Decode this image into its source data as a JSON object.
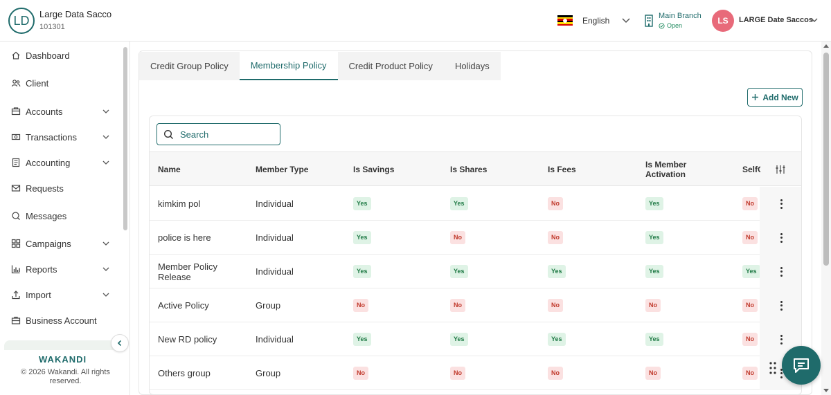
{
  "header": {
    "org_initials": "LD",
    "org_name": "Large Data Sacco",
    "org_code": "101301",
    "language": "English",
    "branch_name": "Main Branch",
    "branch_status": "Open",
    "user_initials": "LS",
    "user_name": "LARGE Date Saccos"
  },
  "sidebar": {
    "items": [
      {
        "label": "Dashboard",
        "icon": "home-icon"
      },
      {
        "label": "Client",
        "icon": "users-icon"
      },
      {
        "label": "Accounts",
        "icon": "wallet-icon",
        "expandable": true
      },
      {
        "label": "Transactions",
        "icon": "money-icon",
        "expandable": true
      },
      {
        "label": "Accounting",
        "icon": "ledger-icon",
        "expandable": true
      },
      {
        "label": "Requests",
        "icon": "mail-icon"
      },
      {
        "label": "Messages",
        "icon": "chat-icon"
      },
      {
        "label": "Campaigns",
        "icon": "grid-icon",
        "expandable": true
      },
      {
        "label": "Reports",
        "icon": "bar-chart-icon",
        "expandable": true
      },
      {
        "label": "Import",
        "icon": "upload-icon",
        "expandable": true
      },
      {
        "label": "Business Account",
        "icon": "briefcase-icon"
      }
    ],
    "brand": "WAKANDI",
    "copyright": "© 2026 Wakandi. All rights reserved."
  },
  "tabs": [
    {
      "label": "Credit Group Policy",
      "active": false
    },
    {
      "label": "Membership Policy",
      "active": true
    },
    {
      "label": "Credit Product Policy",
      "active": false
    },
    {
      "label": "Holidays",
      "active": false
    }
  ],
  "toolbar": {
    "add_label": "Add New"
  },
  "search": {
    "placeholder": "Search",
    "value": ""
  },
  "table": {
    "columns": [
      "Name",
      "Member Type",
      "Is Savings",
      "Is Shares",
      "Is Fees",
      "Is Member Activation",
      "SelfO"
    ],
    "rows": [
      {
        "name": "kimkim pol",
        "member_type": "Individual",
        "flags": [
          "Yes",
          "Yes",
          "No",
          "Yes",
          "No"
        ]
      },
      {
        "name": "police is here",
        "member_type": "Individual",
        "flags": [
          "Yes",
          "No",
          "No",
          "Yes",
          "No"
        ]
      },
      {
        "name": "Member Policy Release",
        "member_type": "Individual",
        "flags": [
          "Yes",
          "Yes",
          "Yes",
          "Yes",
          "Yes"
        ]
      },
      {
        "name": "Active Policy",
        "member_type": "Group",
        "flags": [
          "No",
          "No",
          "No",
          "No",
          "No"
        ]
      },
      {
        "name": "New RD policy",
        "member_type": "Individual",
        "flags": [
          "Yes",
          "Yes",
          "Yes",
          "Yes",
          "No"
        ]
      },
      {
        "name": "Others group",
        "member_type": "Group",
        "flags": [
          "No",
          "No",
          "No",
          "No",
          "No"
        ]
      }
    ]
  },
  "colors": {
    "accent": "#1f6b6b",
    "yes_bg": "#dff3e6",
    "yes_text": "#1f7a45",
    "no_bg": "#fbe1e1",
    "no_text": "#c0392b",
    "user_avatar": "#e86a7a"
  }
}
